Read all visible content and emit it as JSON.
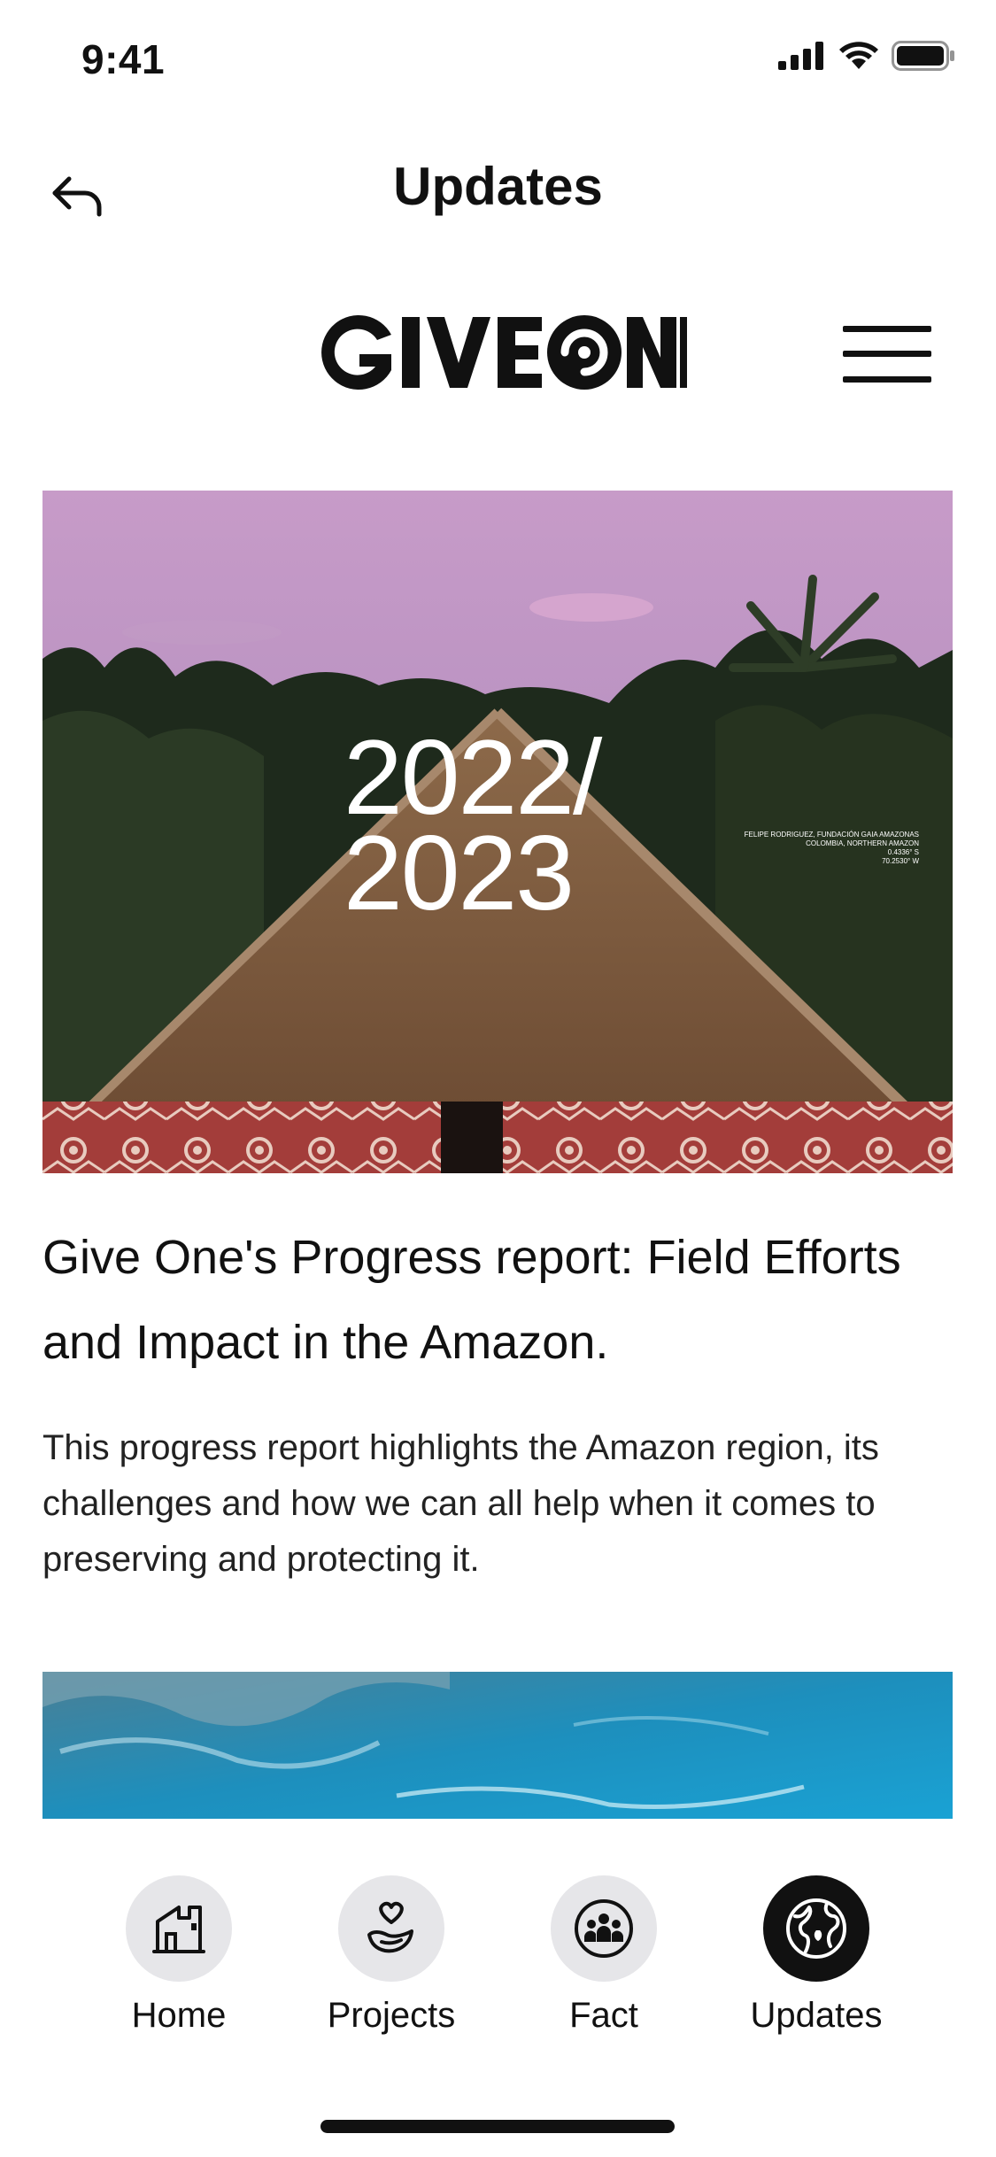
{
  "status_bar": {
    "time": "9:41"
  },
  "nav": {
    "title": "Updates",
    "back_icon": "back-arrow-icon"
  },
  "brand": {
    "logo_text": "GIVEONE",
    "menu_icon": "hamburger-menu-icon"
  },
  "article": {
    "image_overlay_text_line1": "2022/",
    "image_overlay_text_line2": "2023",
    "image_credit_line1": "FELIPE RODRIGUEZ, FUNDACIÓN GAIA AMAZONAS",
    "image_credit_line2": "COLOMBIA, NORTHERN AMAZON",
    "image_credit_line3": "0.4336° S",
    "image_credit_line4": "70.2530° W",
    "title": "Give One's Progress report: Field Efforts and Impact in the Amazon.",
    "description": "This progress report highlights the Amazon region, its challenges and how we can all help when it comes to preserving and protecting it."
  },
  "tabs": [
    {
      "label": "Home",
      "icon": "house-icon",
      "active": false
    },
    {
      "label": "Projects",
      "icon": "heart-hand-icon",
      "active": false
    },
    {
      "label": "Fact",
      "icon": "people-group-icon",
      "active": false
    },
    {
      "label": "Updates",
      "icon": "globe-icon",
      "active": true
    }
  ],
  "colors": {
    "accent": "#111111",
    "tab_inactive_bg": "#e6e6e9",
    "background": "#ffffff"
  }
}
